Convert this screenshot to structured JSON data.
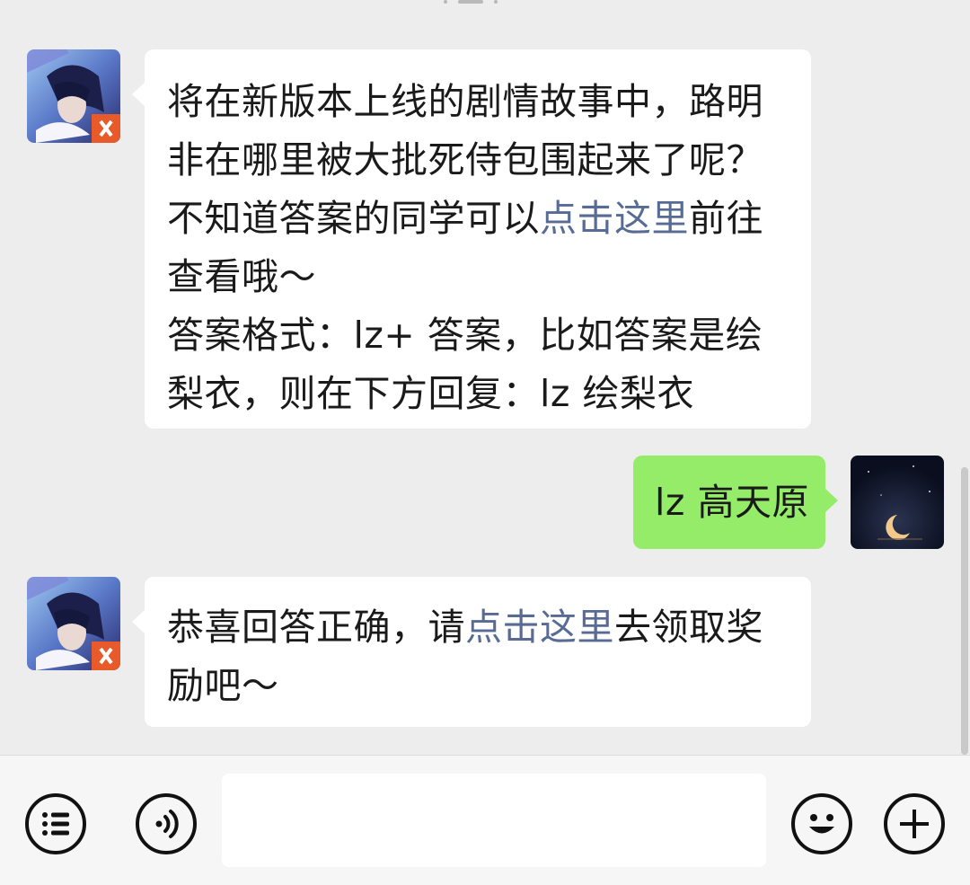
{
  "chat": {
    "messages": [
      {
        "sender": "bot",
        "avatar_icon": "game-avatar-icon",
        "lines": [
          {
            "parts": [
              "将在新版本上线的剧情故事中，路明"
            ]
          },
          {
            "parts": [
              "非在哪里被大批死侍包围起来了呢？"
            ]
          },
          {
            "parts": [
              "不知道答案的同学可以",
              "点击这里",
              "前往"
            ]
          },
          {
            "parts": [
              "查看哦～"
            ]
          },
          {
            "parts": [
              "答案格式：lz+ 答案，比如答案是绘"
            ]
          },
          {
            "parts": [
              "梨衣，则在下方回复：lz 绘梨衣"
            ]
          }
        ]
      },
      {
        "sender": "user",
        "avatar_icon": "moon-avatar-icon",
        "text": "lz 高天原"
      },
      {
        "sender": "bot",
        "avatar_icon": "game-avatar-icon",
        "lines": [
          {
            "parts": [
              "恭喜回答正确，请",
              "点击这里",
              "去领取奖"
            ]
          },
          {
            "parts": [
              "励吧～"
            ]
          }
        ]
      }
    ]
  },
  "input_bar": {
    "menu_icon": "list-menu-icon",
    "voice_icon": "voice-icon",
    "emoji_icon": "emoji-icon",
    "plus_icon": "plus-icon",
    "input_value": ""
  },
  "colors": {
    "background": "#ededed",
    "user_bubble": "#95ec69",
    "bot_bubble": "#ffffff",
    "link": "#576b95"
  }
}
